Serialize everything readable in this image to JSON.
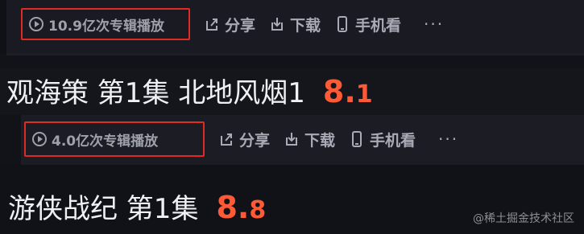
{
  "section1": {
    "play_count": "10.9亿次专辑播放",
    "share_label": "分享",
    "download_label": "下载",
    "mobile_label": "手机看",
    "more_label": "···",
    "title": "观海策 第1集 北地风烟1",
    "score_int": "8.",
    "score_dec": "1"
  },
  "section2": {
    "play_count": "4.0亿次专辑播放",
    "share_label": "分享",
    "download_label": "下载",
    "mobile_label": "手机看",
    "more_label": "···",
    "title": "游侠战纪 第1集",
    "score_int": "8.",
    "score_dec": "8"
  },
  "watermark": "@稀土掘金技术社区",
  "colors": {
    "highlight_border": "#e02a24",
    "score": "#ff5a36",
    "toolbar_text": "#a8abb5",
    "title_text": "#eef0f4",
    "background": "#15161b"
  },
  "icons": {
    "play_count": "play-circle-icon",
    "share": "share-icon",
    "download": "download-icon",
    "mobile": "mobile-phone-icon",
    "more": "more-icon"
  }
}
